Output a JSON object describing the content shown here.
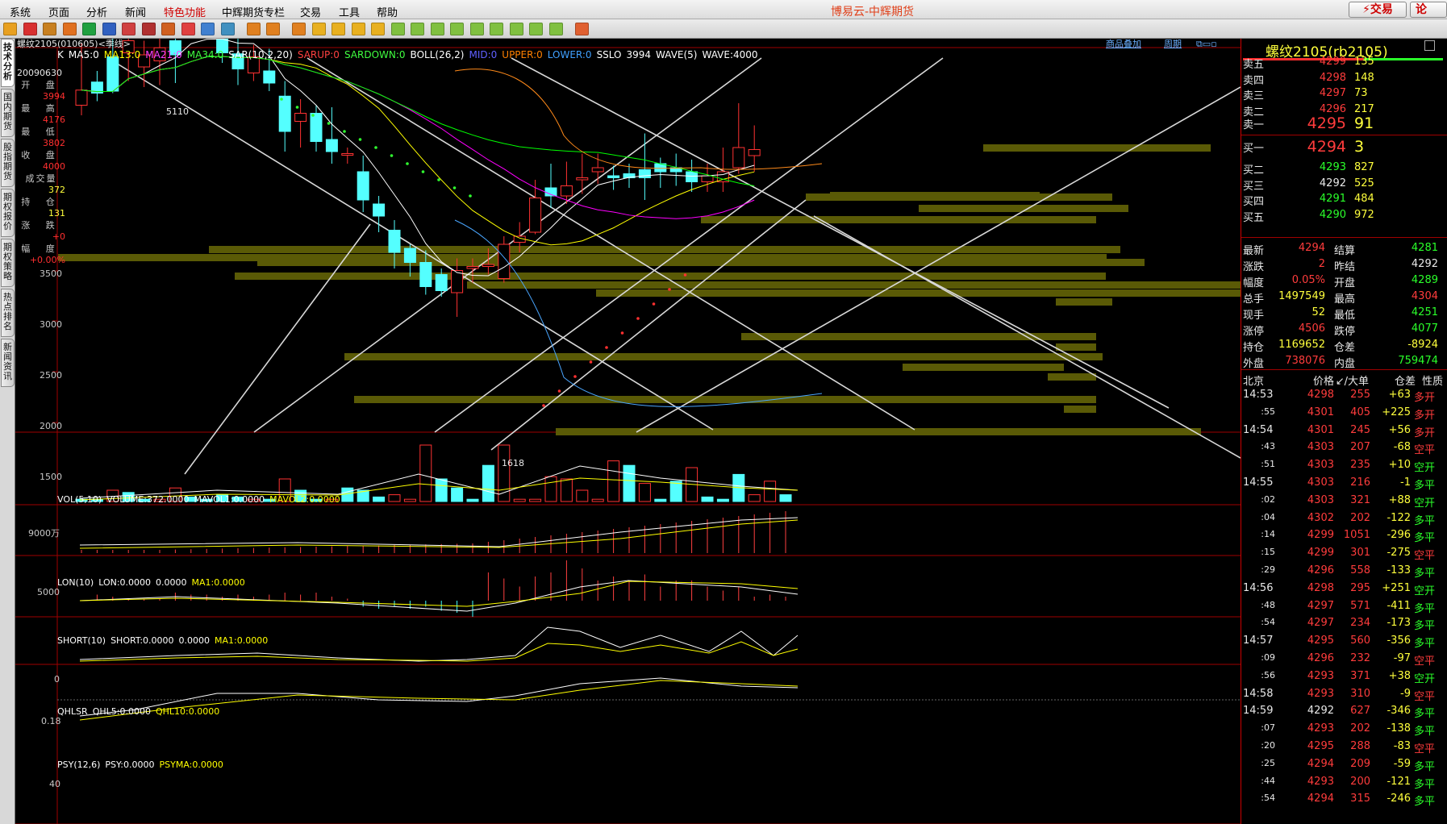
{
  "menu": {
    "items": [
      "系统",
      "页面",
      "分析",
      "新闻",
      "特色功能",
      "中辉期货专栏",
      "交易",
      "工具",
      "帮助"
    ],
    "app_title": "博易云-中辉期货",
    "trade_button": "交易",
    "lun_button": "论"
  },
  "left_tabs": [
    "技术分析",
    "国内期货",
    "股指期货",
    "期权报价",
    "期权策略",
    "热点排名",
    "新闻资讯"
  ],
  "chart": {
    "symbol": "螺纹2105(010605)<季线>",
    "links": [
      "商品叠加",
      "周期"
    ],
    "indicator_line": [
      "K",
      "MA5:0",
      "MA13:0",
      "MA21:0",
      "MA34:0",
      "SAR(10,2,20)",
      "SARUP:0",
      "SARDOWN:0",
      "BOLL(26,2)",
      "MID:0",
      "UPPER:0",
      "LOWER:0",
      "SSLO",
      "3994",
      "WAVE(5)",
      "WAVE:4000"
    ],
    "info": {
      "date": "20090630",
      "open_label": "开 盘",
      "open": "3994",
      "high_label": "最 高",
      "high": "4176",
      "low_label": "最 低",
      "low": "3802",
      "close_label": "收 盘",
      "close": "4000",
      "vol_label": "成交量",
      "vol": "372",
      "oi_label": "持 仓",
      "oi": "131",
      "chg_label": "涨 跌",
      "chg": "+0",
      "pct_label": "幅 度",
      "pct": "+0.00%"
    },
    "price_axis": [
      "3500",
      "3000",
      "2500",
      "2000",
      "1500"
    ],
    "annotations": {
      "high": "5110",
      "low": "1618"
    },
    "vol": {
      "header": [
        "VOL(5,10)",
        "VOLUME:372.0000",
        "MAVOL1:0.0000",
        "MAVOL2:0.0000"
      ],
      "axis": "9000万"
    },
    "lon": {
      "header": [
        "LON(10)",
        "LON:0.0000",
        "0.0000",
        "MA1:0.0000"
      ],
      "axis": "5000"
    },
    "short": {
      "header": [
        "SHORT(10)",
        "SHORT:0.0000",
        "0.0000",
        "MA1:0.0000"
      ],
      "axis": "0"
    },
    "qhlsr": {
      "header": [
        "QHLSR",
        "QHL5:0.0000",
        "QHL10:0.0000"
      ],
      "axis": "0.18"
    },
    "psy": {
      "header": [
        "PSY(12,6)",
        "PSY:0.0000",
        "PSYMA:0.0000"
      ],
      "axis": "40"
    },
    "candles": [
      [
        1930,
        2005,
        1880,
        2240
      ],
      [
        2045,
        1990,
        1950,
        2100
      ],
      [
        2170,
        2000,
        1990,
        2450
      ],
      [
        2190,
        2250,
        2050,
        2320
      ],
      [
        2120,
        2180,
        2020,
        2250
      ],
      [
        2150,
        2215,
        2030,
        2360
      ],
      [
        2250,
        2180,
        2040,
        2440
      ],
      [
        2410,
        2350,
        2280,
        2550
      ],
      [
        2410,
        2360,
        2290,
        2560
      ],
      [
        2300,
        2190,
        2140,
        2480
      ],
      [
        2185,
        2110,
        2030,
        2330
      ],
      [
        2090,
        2170,
        2050,
        2230
      ],
      [
        2100,
        2040,
        2000,
        2210
      ],
      [
        1975,
        1800,
        1700,
        2050
      ],
      [
        1850,
        1890,
        1720,
        1960
      ],
      [
        1890,
        1750,
        1700,
        1930
      ],
      [
        1760,
        1700,
        1640,
        1920
      ],
      [
        1690,
        1690,
        1640,
        1720
      ],
      [
        1600,
        1460,
        1400,
        1680
      ],
      [
        1440,
        1380,
        1300,
        1480
      ],
      [
        1310,
        1200,
        1120,
        1360
      ],
      [
        1220,
        1150,
        1080,
        1240
      ],
      [
        1150,
        1030,
        990,
        1210
      ],
      [
        1090,
        1010,
        980,
        1120
      ],
      [
        1000,
        1110,
        880,
        1170
      ],
      [
        1120,
        1130,
        1050,
        1170
      ],
      [
        1130,
        1140,
        1090,
        1220
      ],
      [
        1070,
        1240,
        1050,
        1280
      ],
      [
        1250,
        1280,
        1200,
        1350
      ],
      [
        1300,
        1470,
        1290,
        1560
      ],
      [
        1520,
        1480,
        1420,
        1640
      ],
      [
        1480,
        1530,
        1440,
        1650
      ],
      [
        1560,
        1570,
        1490,
        1690
      ],
      [
        1600,
        1620,
        1540,
        1690
      ],
      [
        1580,
        1570,
        1510,
        1630
      ],
      [
        1590,
        1570,
        1520,
        1640
      ],
      [
        1610,
        1570,
        1460,
        1790
      ],
      [
        1640,
        1600,
        1520,
        1670
      ],
      [
        1620,
        1600,
        1530,
        1690
      ],
      [
        1600,
        1550,
        1500,
        1660
      ],
      [
        1550,
        1580,
        1500,
        1640
      ],
      [
        1550,
        1600,
        1500,
        1720
      ],
      [
        1620,
        1720,
        1590,
        1940
      ],
      [
        1680,
        1710,
        1600,
        1830
      ]
    ],
    "vol_bars": [
      [
        0,
        1
      ],
      [
        0,
        1
      ],
      [
        1,
        5
      ],
      [
        0,
        4
      ],
      [
        0,
        1
      ],
      [
        1,
        1
      ],
      [
        1,
        6
      ],
      [
        0,
        2
      ],
      [
        0,
        1
      ],
      [
        0,
        3
      ],
      [
        0,
        2
      ],
      [
        1,
        1
      ],
      [
        0,
        1
      ],
      [
        1,
        10
      ],
      [
        0,
        5
      ],
      [
        0,
        1
      ],
      [
        1,
        1
      ],
      [
        0,
        6
      ],
      [
        0,
        5
      ],
      [
        0,
        2
      ],
      [
        1,
        3
      ],
      [
        1,
        1
      ],
      [
        1,
        25
      ],
      [
        0,
        10
      ],
      [
        0,
        6
      ],
      [
        0,
        1
      ],
      [
        0,
        16
      ],
      [
        1,
        25
      ],
      [
        1,
        1
      ],
      [
        1,
        1
      ],
      [
        1,
        11
      ],
      [
        1,
        10
      ],
      [
        1,
        5
      ],
      [
        1,
        1
      ],
      [
        1,
        18
      ],
      [
        0,
        16
      ],
      [
        1,
        8
      ],
      [
        0,
        1
      ],
      [
        0,
        9
      ],
      [
        1,
        15
      ],
      [
        0,
        2
      ],
      [
        0,
        1
      ],
      [
        0,
        12
      ],
      [
        1,
        3
      ],
      [
        1,
        9
      ],
      [
        0,
        3
      ]
    ]
  },
  "quote": {
    "title": "螺纹2105(rb2105)",
    "asks": [
      {
        "l": "卖五",
        "p": "4299",
        "v": "135"
      },
      {
        "l": "卖四",
        "p": "4298",
        "v": "148"
      },
      {
        "l": "卖三",
        "p": "4297",
        "v": "73"
      },
      {
        "l": "卖二",
        "p": "4296",
        "v": "217"
      },
      {
        "l": "卖一",
        "p": "4295",
        "v": "91"
      }
    ],
    "bids": [
      {
        "l": "买一",
        "p": "4294",
        "v": "3"
      },
      {
        "l": "买二",
        "p": "4293",
        "v": "827"
      },
      {
        "l": "买三",
        "p": "4292",
        "v": "525"
      },
      {
        "l": "买四",
        "p": "4291",
        "v": "484"
      },
      {
        "l": "买五",
        "p": "4290",
        "v": "972"
      }
    ],
    "stats": [
      {
        "l1": "最新",
        "v1": "4294",
        "l2": "结算",
        "v2": "4281"
      },
      {
        "l1": "涨跌",
        "v1": "2",
        "l2": "昨结",
        "v2": "4292"
      },
      {
        "l1": "幅度",
        "v1": "0.05%",
        "l2": "开盘",
        "v2": "4289"
      },
      {
        "l1": "总手",
        "v1": "1497549",
        "l2": "最高",
        "v2": "4304"
      },
      {
        "l1": "现手",
        "v1": "52",
        "l2": "最低",
        "v2": "4251"
      },
      {
        "l1": "涨停",
        "v1": "4506",
        "l2": "跌停",
        "v2": "4077"
      },
      {
        "l1": "持仓",
        "v1": "1169652",
        "l2": "仓差",
        "v2": "-8924"
      },
      {
        "l1": "外盘",
        "v1": "738076",
        "l2": "内盘",
        "v2": "759474"
      }
    ],
    "tick_header": [
      "北京",
      "价格",
      "↙/大单",
      "仓差",
      "性质"
    ],
    "ticks": [
      {
        "t": "14:53",
        "p": "4298",
        "v": "255",
        "d": "+63",
        "n": "多开",
        "pc": "red",
        "nc": "red"
      },
      {
        "t": ":55",
        "p": "4301",
        "v": "405",
        "d": "+225",
        "n": "多开",
        "pc": "red",
        "nc": "red"
      },
      {
        "t": "14:54",
        "p": "4301",
        "v": "245",
        "d": "+56",
        "n": "多开",
        "pc": "red",
        "nc": "red"
      },
      {
        "t": ":43",
        "p": "4303",
        "v": "207",
        "d": "-68",
        "n": "空平",
        "pc": "red",
        "nc": "red"
      },
      {
        "t": ":51",
        "p": "4303",
        "v": "235",
        "d": "+10",
        "n": "空开",
        "pc": "red",
        "nc": "green"
      },
      {
        "t": "14:55",
        "p": "4303",
        "v": "216",
        "d": "-1",
        "n": "多平",
        "pc": "red",
        "nc": "green"
      },
      {
        "t": ":02",
        "p": "4303",
        "v": "321",
        "d": "+88",
        "n": "空开",
        "pc": "red",
        "nc": "green"
      },
      {
        "t": ":04",
        "p": "4302",
        "v": "202",
        "d": "-122",
        "n": "多平",
        "pc": "red",
        "nc": "green"
      },
      {
        "t": ":14",
        "p": "4299",
        "v": "1051",
        "d": "-296",
        "n": "多平",
        "pc": "red",
        "nc": "green"
      },
      {
        "t": ":15",
        "p": "4299",
        "v": "301",
        "d": "-275",
        "n": "空平",
        "pc": "red",
        "nc": "red"
      },
      {
        "t": ":29",
        "p": "4296",
        "v": "558",
        "d": "-133",
        "n": "多平",
        "pc": "red",
        "nc": "green"
      },
      {
        "t": "14:56",
        "p": "4298",
        "v": "295",
        "d": "+251",
        "n": "空开",
        "pc": "red",
        "nc": "green"
      },
      {
        "t": ":48",
        "p": "4297",
        "v": "571",
        "d": "-411",
        "n": "多平",
        "pc": "red",
        "nc": "green"
      },
      {
        "t": ":54",
        "p": "4297",
        "v": "234",
        "d": "-173",
        "n": "多平",
        "pc": "red",
        "nc": "green"
      },
      {
        "t": "14:57",
        "p": "4295",
        "v": "560",
        "d": "-356",
        "n": "多平",
        "pc": "red",
        "nc": "green"
      },
      {
        "t": ":09",
        "p": "4296",
        "v": "232",
        "d": "-97",
        "n": "空平",
        "pc": "red",
        "nc": "red"
      },
      {
        "t": ":56",
        "p": "4293",
        "v": "371",
        "d": "+38",
        "n": "空开",
        "pc": "red",
        "nc": "green"
      },
      {
        "t": "14:58",
        "p": "4293",
        "v": "310",
        "d": "-9",
        "n": "空平",
        "pc": "red",
        "nc": "red"
      },
      {
        "t": "14:59",
        "p": "4292",
        "v": "627",
        "d": "-346",
        "n": "多平",
        "pc": "white",
        "nc": "green"
      },
      {
        "t": ":07",
        "p": "4293",
        "v": "202",
        "d": "-138",
        "n": "多平",
        "pc": "red",
        "nc": "green"
      },
      {
        "t": ":20",
        "p": "4295",
        "v": "288",
        "d": "-83",
        "n": "空平",
        "pc": "red",
        "nc": "red"
      },
      {
        "t": ":25",
        "p": "4294",
        "v": "209",
        "d": "-59",
        "n": "多平",
        "pc": "red",
        "nc": "green"
      },
      {
        "t": ":44",
        "p": "4293",
        "v": "200",
        "d": "-121",
        "n": "多平",
        "pc": "red",
        "nc": "green"
      },
      {
        "t": ":54",
        "p": "4294",
        "v": "315",
        "d": "-246",
        "n": "多平",
        "pc": "red",
        "nc": "green"
      }
    ]
  },
  "colors": {
    "up": "#ff3232",
    "down": "#54ffff",
    "ma5": "#ffffff",
    "ma13": "#ffff00",
    "ma21": "#ff00ff",
    "ma34": "#00ff00",
    "panel_border": "#a00000"
  }
}
